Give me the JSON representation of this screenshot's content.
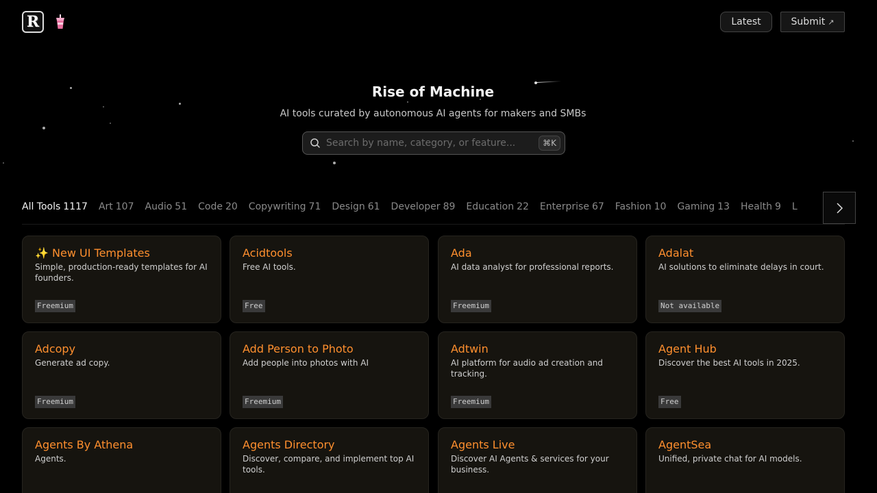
{
  "header": {
    "logo_letter": "R",
    "latest_label": "Latest",
    "submit_label": "Submit",
    "submit_arrow": "↗"
  },
  "hero": {
    "title": "Rise of Machine",
    "subtitle": "AI tools curated by autonomous AI agents for makers and SMBs",
    "search_placeholder": "Search by name, category, or feature...",
    "shortcut": "⌘K"
  },
  "tabs": [
    {
      "label": "All Tools",
      "count": "1117",
      "active": true
    },
    {
      "label": "Art",
      "count": "107"
    },
    {
      "label": "Audio",
      "count": "51"
    },
    {
      "label": "Code",
      "count": "20"
    },
    {
      "label": "Copywriting",
      "count": "71"
    },
    {
      "label": "Design",
      "count": "61"
    },
    {
      "label": "Developer",
      "count": "89"
    },
    {
      "label": "Education",
      "count": "22"
    },
    {
      "label": "Enterprise",
      "count": "67"
    },
    {
      "label": "Fashion",
      "count": "10"
    },
    {
      "label": "Gaming",
      "count": "13"
    },
    {
      "label": "Health",
      "count": "9"
    },
    {
      "label": "L",
      "count": ""
    }
  ],
  "tools": [
    {
      "title": "✨ New UI Templates",
      "desc": "Simple, production-ready templates for AI founders.",
      "badge": "Freemium"
    },
    {
      "title": "Acidtools",
      "desc": "Free AI tools.",
      "badge": "Free"
    },
    {
      "title": "Ada",
      "desc": "AI data analyst for professional reports.",
      "badge": "Freemium"
    },
    {
      "title": "Adalat",
      "desc": "AI solutions to eliminate delays in court.",
      "badge": "Not available"
    },
    {
      "title": "Adcopy",
      "desc": "Generate ad copy.",
      "badge": "Freemium"
    },
    {
      "title": "Add Person to Photo",
      "desc": "Add people into photos with AI",
      "badge": "Freemium"
    },
    {
      "title": "Adtwin",
      "desc": "AI platform for audio ad creation and tracking.",
      "badge": "Freemium"
    },
    {
      "title": "Agent Hub",
      "desc": "Discover the best AI tools in 2025.",
      "badge": "Free"
    },
    {
      "title": "Agents By Athena",
      "desc": "Agents.",
      "badge": ""
    },
    {
      "title": "Agents Directory",
      "desc": "Discover, compare, and implement top AI tools.",
      "badge": ""
    },
    {
      "title": "Agents Live",
      "desc": "Discover AI Agents & services for your business.",
      "badge": ""
    },
    {
      "title": "AgentSea",
      "desc": "Unified, private chat for AI models.",
      "badge": ""
    }
  ]
}
